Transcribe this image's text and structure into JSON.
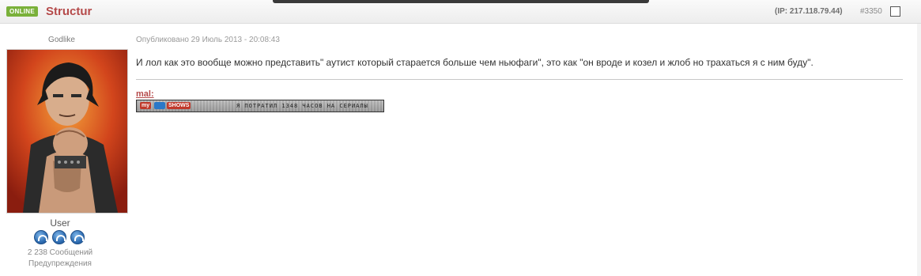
{
  "post": {
    "status_badge": "ONLINE",
    "author": "Structur",
    "ip": "(IP: 217.118.79.44)",
    "number": "#3350",
    "date": "Опубликовано 29 Июль 2013 - 20:08:43",
    "body": "И лол как это вообще можно представить\" аутист который старается больше чем ньюфаги\", это как \"он вроде и козел и жлоб но трахаться я с ним буду\"."
  },
  "author_panel": {
    "rank_title": "Godlike",
    "avatar_icon": "avatar-illustration",
    "group": "User",
    "pips": 3,
    "post_count": "2 238 Сообщений",
    "warnings": "Предупреждения"
  },
  "signature": {
    "link": "mal:",
    "banner": {
      "logo_1": "my",
      "logo_2": "SHOWS",
      "text": "Я ПОТРАТИЛ 1348 ЧАСОВ НА СЕРИАЛЫ"
    }
  },
  "colors": {
    "accent": "#b54a4a",
    "online": "#7ab13a",
    "pip": "#2f6db2"
  }
}
